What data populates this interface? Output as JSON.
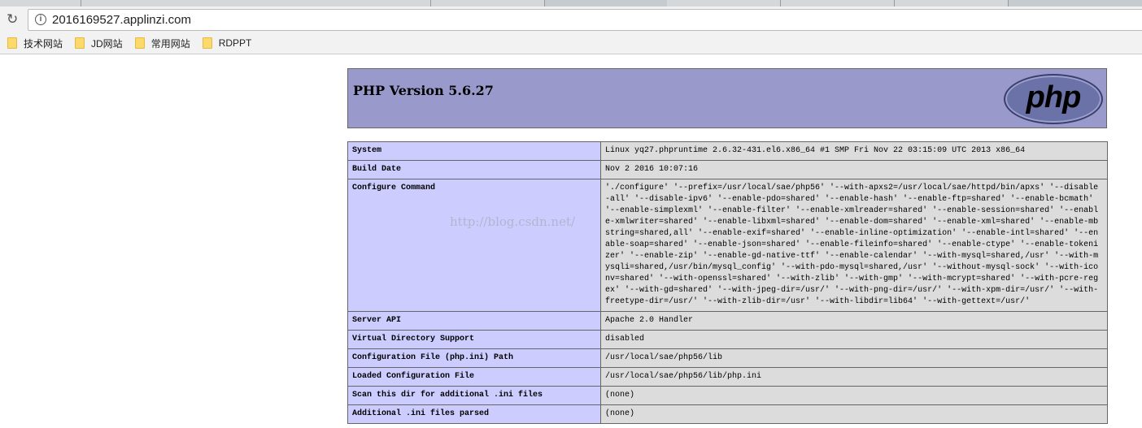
{
  "browser": {
    "url": "2016169527.applinzi.com",
    "bookmarks": [
      "技术网站",
      "JD网站",
      "常用网站",
      "RDPPT"
    ]
  },
  "header": {
    "title": "PHP Version 5.6.27",
    "logo": "php"
  },
  "watermark": "http://blog.csdn.net/",
  "rows": [
    {
      "label": "System",
      "value": "Linux yq27.phpruntime 2.6.32-431.el6.x86_64 #1 SMP Fri Nov 22 03:15:09 UTC 2013 x86_64"
    },
    {
      "label": "Build Date",
      "value": "Nov 2 2016 10:07:16"
    },
    {
      "label": "Configure Command",
      "value": "'./configure' '--prefix=/usr/local/sae/php56' '--with-apxs2=/usr/local/sae/httpd/bin/apxs' '--disable-all' '--disable-ipv6' '--enable-pdo=shared' '--enable-hash' '--enable-ftp=shared' '--enable-bcmath' '--enable-simplexml' '--enable-filter' '--enable-xmlreader=shared' '--enable-session=shared' '--enable-xmlwriter=shared' '--enable-libxml=shared' '--enable-dom=shared' '--enable-xml=shared' '--enable-mbstring=shared,all' '--enable-exif=shared' '--enable-inline-optimization' '--enable-intl=shared' '--enable-soap=shared' '--enable-json=shared' '--enable-fileinfo=shared' '--enable-ctype' '--enable-tokenizer' '--enable-zip' '--enable-gd-native-ttf' '--enable-calendar' '--with-mysql=shared,/usr' '--with-mysqli=shared,/usr/bin/mysql_config' '--with-pdo-mysql=shared,/usr' '--without-mysql-sock' '--with-iconv=shared' '--with-openssl=shared' '--with-zlib' '--with-gmp' '--with-mcrypt=shared' '--with-pcre-regex' '--with-gd=shared' '--with-jpeg-dir=/usr/' '--with-png-dir=/usr/' '--with-xpm-dir=/usr/' '--with-freetype-dir=/usr/' '--with-zlib-dir=/usr' '--with-libdir=lib64' '--with-gettext=/usr/'"
    },
    {
      "label": "Server API",
      "value": "Apache 2.0 Handler"
    },
    {
      "label": "Virtual Directory Support",
      "value": "disabled"
    },
    {
      "label": "Configuration File (php.ini) Path",
      "value": "/usr/local/sae/php56/lib"
    },
    {
      "label": "Loaded Configuration File",
      "value": "/usr/local/sae/php56/lib/php.ini"
    },
    {
      "label": "Scan this dir for additional .ini files",
      "value": "(none)"
    },
    {
      "label": "Additional .ini files parsed",
      "value": "(none)"
    }
  ]
}
